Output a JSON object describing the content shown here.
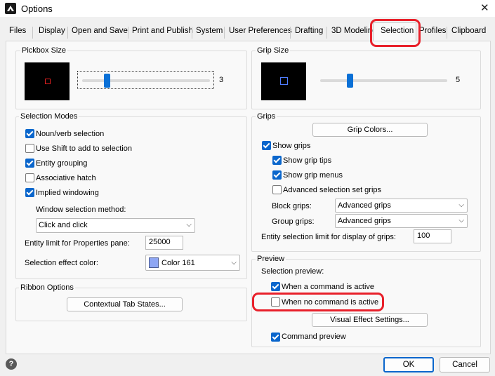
{
  "window": {
    "title": "Options",
    "close_glyph": "✕"
  },
  "tabs": [
    {
      "label": "Files"
    },
    {
      "label": "Display"
    },
    {
      "label": "Open and Save"
    },
    {
      "label": "Print and Publish"
    },
    {
      "label": "System"
    },
    {
      "label": "User Preferences"
    },
    {
      "label": "Drafting"
    },
    {
      "label": "3D Modeling"
    },
    {
      "label": "Selection",
      "active": true
    },
    {
      "label": "Profiles"
    },
    {
      "label": "Clipboard"
    }
  ],
  "pickbox": {
    "title": "Pickbox Size",
    "value": "3",
    "level": 0.19
  },
  "selection_modes": {
    "title": "Selection Modes",
    "options": [
      {
        "label": "Noun/verb selection",
        "checked": true
      },
      {
        "label": "Use Shift to add to selection",
        "checked": false
      },
      {
        "label": "Entity grouping",
        "checked": true
      },
      {
        "label": "Associative hatch",
        "checked": false
      },
      {
        "label": "Implied windowing",
        "checked": true
      }
    ],
    "window_method_label": "Window selection method:",
    "window_method_value": "Click and click",
    "entity_limit_label": "Entity limit for Properties pane:",
    "entity_limit_value": "25000",
    "effect_color_label": "Selection effect color:",
    "effect_color_value": "Color 161",
    "effect_color_swatch": "#8ea6f4"
  },
  "ribbon": {
    "title": "Ribbon Options",
    "button": "Contextual Tab States..."
  },
  "grip_size": {
    "title": "Grip Size",
    "value": "5",
    "level": 0.23
  },
  "grips": {
    "title": "Grips",
    "colors_button": "Grip Colors...",
    "options": [
      {
        "label": "Show grips",
        "checked": true
      },
      {
        "label": "Show grip tips",
        "checked": true
      },
      {
        "label": "Show grip menus",
        "checked": true
      },
      {
        "label": "Advanced selection set grips",
        "checked": false
      }
    ],
    "block_label": "Block grips:",
    "block_value": "Advanced grips",
    "group_label": "Group grips:",
    "group_value": "Advanced grips",
    "limit_label": "Entity selection limit for display of grips:",
    "limit_value": "100"
  },
  "preview": {
    "title": "Preview",
    "subtitle": "Selection preview:",
    "when_active": {
      "label": "When a command is active",
      "checked": true
    },
    "when_none": {
      "label": "When no command is active",
      "checked": false
    },
    "visual_button": "Visual Effect Settings...",
    "command_preview": {
      "label": "Command preview",
      "checked": true
    }
  },
  "footer": {
    "help": "?",
    "ok": "OK",
    "cancel": "Cancel"
  },
  "colors": {
    "accent": "#0a66cc",
    "highlight": "#e8202a"
  }
}
